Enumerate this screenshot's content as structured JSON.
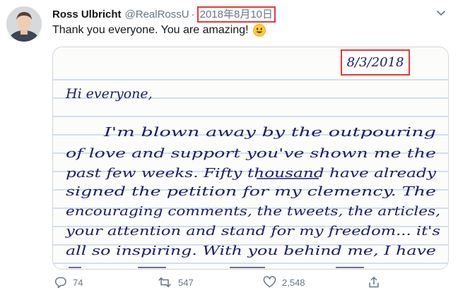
{
  "tweet": {
    "author_name": "Ross Ulbricht",
    "handle": "@RealRossU",
    "separator": "·",
    "timestamp": "2018年8月10日",
    "text": "Thank you everyone. You are amazing!",
    "emoji_icon": "smiley-face-icon"
  },
  "letter": {
    "date": "8/3/2018",
    "greeting": "Hi everyone,",
    "lines": [
      "I'm blown away by the outpouring",
      "of love and support you've shown me the",
      "past few weeks. Fifty thousand have already",
      "signed the petition for my clemency. The",
      "encouraging comments, the tweets, the articles,",
      "your attention and stand for my freedom... it's",
      "all so inspiring. With you behind me, I have"
    ]
  },
  "actions": {
    "reply_count": "74",
    "retweet_count": "547",
    "like_count": "2,548"
  },
  "colors": {
    "highlight_box": "#e53935",
    "ink": "#1c1c6e",
    "muted_text": "#657786",
    "rule_lines": "#a9c2e6"
  }
}
